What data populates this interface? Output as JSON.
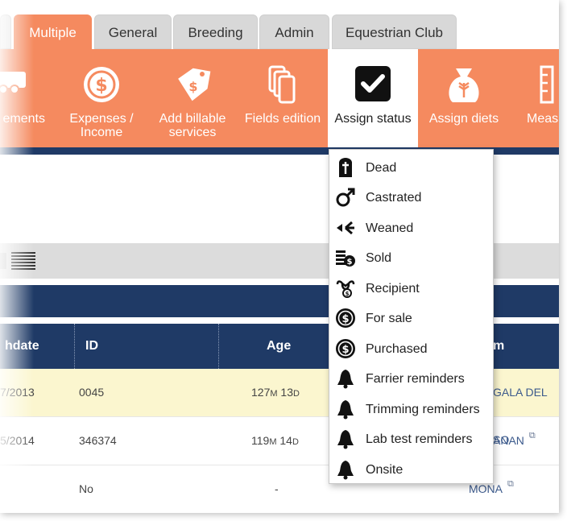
{
  "tabs": [
    {
      "label": "Multiple",
      "active": true
    },
    {
      "label": "General"
    },
    {
      "label": "Breeding"
    },
    {
      "label": "Admin"
    },
    {
      "label": "Equestrian Club"
    }
  ],
  "toolbar": {
    "items": [
      {
        "label": "ements",
        "icon": "trailer-icon"
      },
      {
        "label": "Expenses / Income",
        "icon": "dollar-coin-icon"
      },
      {
        "label": "Add billable services",
        "icon": "price-tag-icon"
      },
      {
        "label": "Fields edition",
        "icon": "documents-icon"
      },
      {
        "label": "Assign status",
        "icon": "checkbox-icon",
        "selected": true
      },
      {
        "label": "Assign diets",
        "icon": "grain-sack-icon"
      },
      {
        "label": "Meas",
        "icon": "ruler-icon"
      }
    ]
  },
  "table": {
    "headers": [
      "hdate",
      "ID",
      "Age",
      "m"
    ],
    "rows": [
      {
        "birthdate": "7/2013",
        "id": "0045",
        "age": "127",
        "age_m": "M",
        "age_d_num": "13",
        "age_d": "D",
        "name": "GALA DEL SO",
        "highlight": true
      },
      {
        "birthdate": "5/2014",
        "id": "346374",
        "age": "119",
        "age_m": "M",
        "age_d_num": "14",
        "age_d": "D",
        "name": "ANAN"
      },
      {
        "birthdate": "",
        "id": "No",
        "age": "-",
        "age_m": "",
        "age_d_num": "",
        "age_d": "",
        "name": "MONA"
      }
    ]
  },
  "status_menu": {
    "items": [
      {
        "label": "Dead",
        "icon": "cross-tombstone-icon"
      },
      {
        "label": "Castrated",
        "icon": "male-symbol-icon"
      },
      {
        "label": "Weaned",
        "icon": "branch-arrow-icon"
      },
      {
        "label": "Sold",
        "icon": "money-stack-icon"
      },
      {
        "label": "Recipient",
        "icon": "uterus-icon"
      },
      {
        "label": "For sale",
        "icon": "dollar-circle-icon"
      },
      {
        "label": "Purchased",
        "icon": "dollar-circle-icon"
      },
      {
        "label": "Farrier reminders",
        "icon": "bell-icon"
      },
      {
        "label": "Trimming reminders",
        "icon": "bell-icon"
      },
      {
        "label": "Lab test reminders",
        "icon": "bell-icon"
      },
      {
        "label": "Onsite",
        "icon": "bell-icon"
      }
    ]
  },
  "colors": {
    "accent": "#f58a5f",
    "navy": "#1f3a66",
    "highlight_row": "#fbf6cf"
  }
}
